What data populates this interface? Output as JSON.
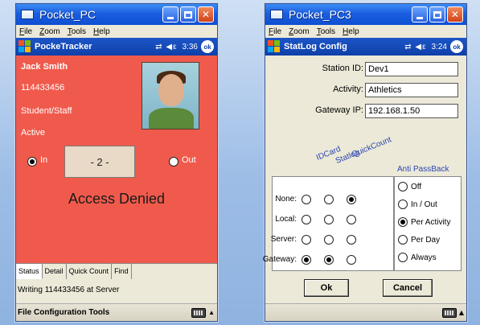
{
  "left": {
    "window_title": "Pocket_PC",
    "menu": [
      "File",
      "Zoom",
      "Tools",
      "Help"
    ],
    "app_name": "PockeTracker",
    "time": "3:36",
    "ok": "ok",
    "person": {
      "name": "Jack Smith",
      "id": "114433456",
      "role": "Student/Staff",
      "state": "Active"
    },
    "direction": {
      "in_label": "In",
      "out_label": "Out",
      "selected": "In"
    },
    "counter": "- 2 -",
    "message": "Access Denied",
    "tabs": [
      "Status",
      "Detail",
      "Quick Count",
      "Find"
    ],
    "active_tab": "Status",
    "status_line": "Writing 114433456 at Server",
    "command_bar": "File Configuration Tools"
  },
  "right": {
    "window_title": "Pocket_PC3",
    "menu": [
      "File",
      "Zoom",
      "Tools",
      "Help"
    ],
    "app_name": "StatLog Config",
    "time": "3:24",
    "ok": "ok",
    "fields": {
      "station_label": "Station ID:",
      "station_value": "Dev1",
      "activity_label": "Activity:",
      "activity_value": "Athletics",
      "gateway_label": "Gateway IP:",
      "gateway_value": "192.168.1.50"
    },
    "columns": [
      "IDCard",
      "Statlog",
      "QuickCount"
    ],
    "rows": [
      {
        "label": "None:",
        "selected": [
          false,
          false,
          true
        ]
      },
      {
        "label": "Local:",
        "selected": [
          false,
          false,
          false
        ]
      },
      {
        "label": "Server:",
        "selected": [
          false,
          false,
          false
        ]
      },
      {
        "label": "Gateway:",
        "selected": [
          true,
          true,
          false
        ]
      }
    ],
    "anti_passback_label": "Anti PassBack",
    "anti_passback_options": [
      "Off",
      "In / Out",
      "Per Activity",
      "Per Day",
      "Always"
    ],
    "anti_passback_selected": "Per Activity",
    "ok_button": "Ok",
    "cancel_button": "Cancel"
  }
}
